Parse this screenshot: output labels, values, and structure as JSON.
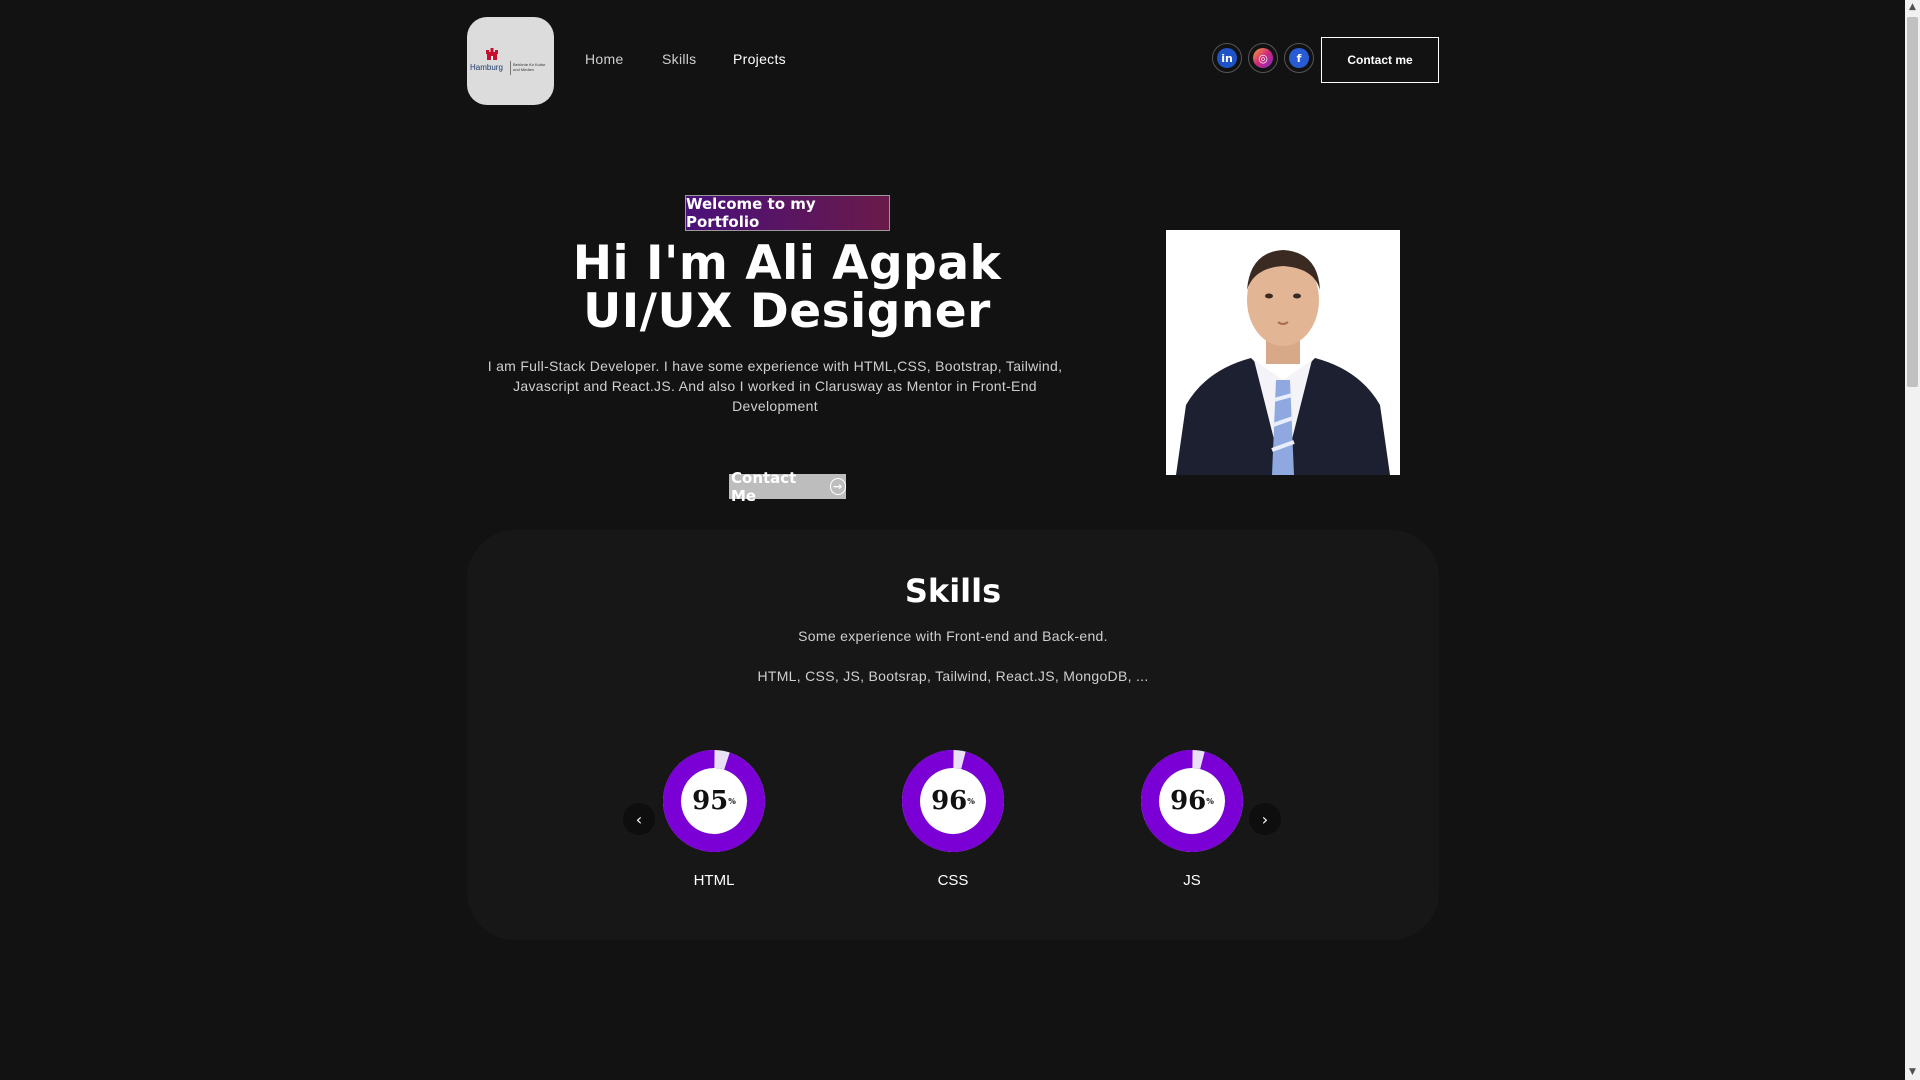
{
  "nav": {
    "logo_brand": "Hamburg",
    "logo_sub": "Behörde für Kultur und Medien",
    "links": [
      {
        "label": "Home"
      },
      {
        "label": "Skills"
      },
      {
        "label": "Projects"
      }
    ],
    "social": [
      {
        "icon": "linkedin-icon",
        "glyph": "in",
        "color": "#1e54c8"
      },
      {
        "icon": "instagram-icon",
        "glyph": "◎",
        "color": "#d0287a"
      },
      {
        "icon": "facebook-icon",
        "glyph": "f",
        "color": "#2a5bd7"
      }
    ],
    "contact_label": "Contact me"
  },
  "hero": {
    "badge": "Welcome to my Portfolio",
    "title_line1": "Hi I'm Ali Agpak",
    "title_line2": "UI/UX Designer",
    "text": "I am Full-Stack Developer. I have some experience with HTML,CSS, Bootstrap, Tailwind, Javascript and React.JS. And also I worked in Clarusway as Mentor in Front-End Development",
    "cta_label": "Contact Me",
    "cta_icon": "arrow-circle-right-icon"
  },
  "skills": {
    "title": "Skills",
    "subtitle": "Some experience with Front-end and Back-end.",
    "list": "HTML, CSS, JS, Bootsrap, Tailwind, React.JS, MongoDB, ...",
    "items": [
      {
        "label": "HTML",
        "value": 95,
        "unit": "%"
      },
      {
        "label": "CSS",
        "value": 96,
        "unit": "%"
      },
      {
        "label": "JS",
        "value": 96,
        "unit": "%"
      }
    ],
    "prev_icon": "chevron-left-icon",
    "next_icon": "chevron-right-icon"
  },
  "colors": {
    "background": "#121212",
    "ring": "#7a00d6",
    "ring_track": "#e9e0f5",
    "card": "#171717"
  }
}
